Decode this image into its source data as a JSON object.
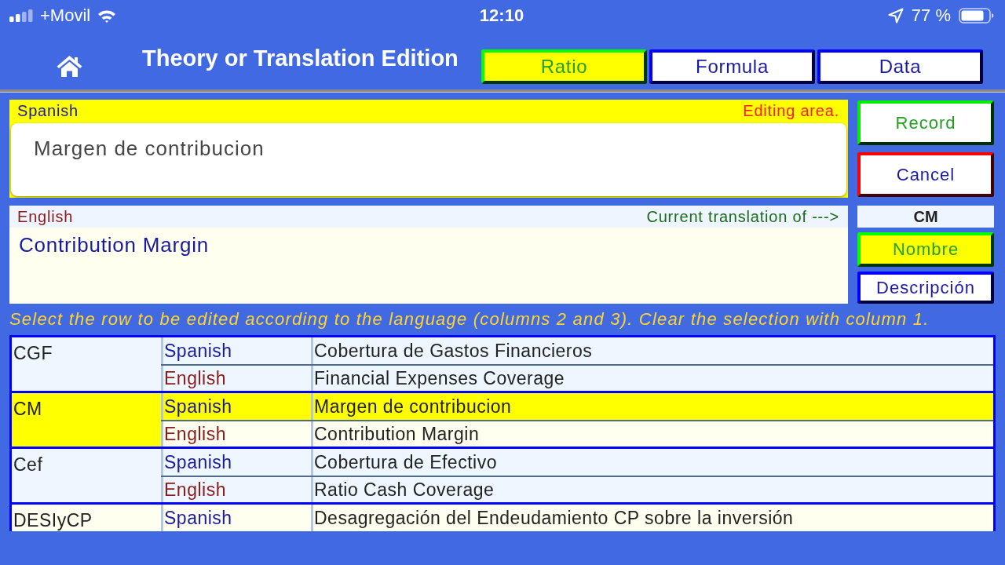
{
  "status_bar": {
    "carrier": "+Movil",
    "time": "12:10",
    "battery": "77 %"
  },
  "header": {
    "title": "Theory or Translation Edition",
    "tabs": [
      {
        "label": "Ratio",
        "selected": true
      },
      {
        "label": "Formula",
        "selected": false
      },
      {
        "label": "Data",
        "selected": false
      }
    ]
  },
  "editor": {
    "language": "Spanish",
    "note": "Editing area.",
    "value": "Margen de contribucion"
  },
  "actions": [
    {
      "label": "Record",
      "kind": "confirm"
    },
    {
      "label": "Cancel",
      "kind": "cancel"
    }
  ],
  "current": {
    "language": "English",
    "note": "Current translation of --->",
    "text": "Contribution Margin"
  },
  "code": "CM",
  "modes": [
    {
      "label": "Nombre",
      "selected": true
    },
    {
      "label": "Descripción",
      "selected": false
    }
  ],
  "instruction": "Select the row to be edited according to the language (columns 2 and 3). Clear the selection with column 1.",
  "table": {
    "groups": [
      {
        "code": "CGF",
        "selected": false,
        "rows": [
          {
            "language": "Spanish",
            "kind": "es",
            "text": "Cobertura de Gastos Financieros",
            "selected": false
          },
          {
            "language": "English",
            "kind": "en",
            "text": "Financial Expenses Coverage",
            "selected": false
          }
        ]
      },
      {
        "code": "CM",
        "selected": true,
        "rows": [
          {
            "language": "Spanish",
            "kind": "es",
            "text": "Margen de contribucion",
            "selected": true
          },
          {
            "language": "English",
            "kind": "en",
            "text": "Contribution Margin",
            "selected": false
          }
        ]
      },
      {
        "code": "Cef",
        "selected": false,
        "rows": [
          {
            "language": "Spanish",
            "kind": "es",
            "text": "Cobertura de Efectivo",
            "selected": false
          },
          {
            "language": "English",
            "kind": "en",
            "text": "Ratio Cash Coverage",
            "selected": false
          }
        ]
      },
      {
        "code": "DESIyCP",
        "selected": false,
        "rows": [
          {
            "language": "Spanish",
            "kind": "es",
            "text": "Desagregación del Endeudamiento CP sobre la inversión",
            "selected": false
          }
        ]
      }
    ]
  }
}
